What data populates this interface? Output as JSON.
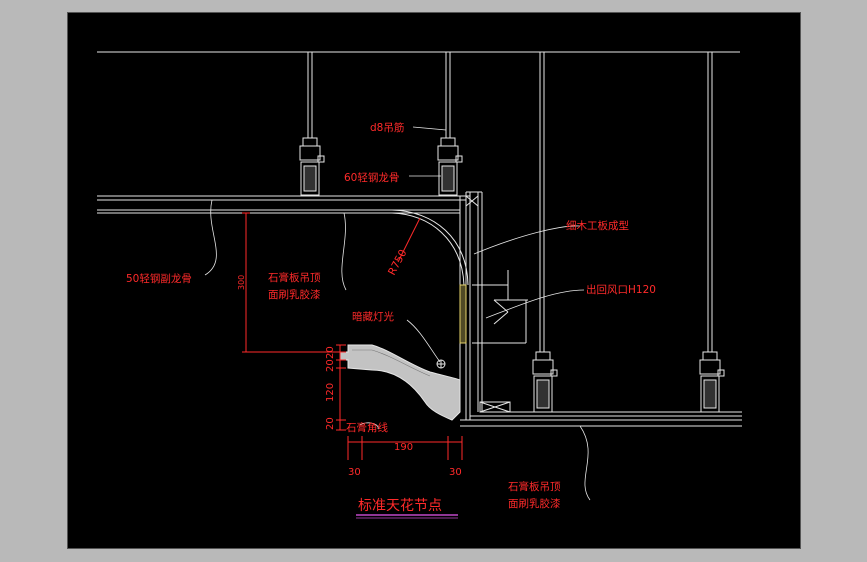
{
  "colors": {
    "background": "#b9b9b9",
    "canvas": "#000000",
    "annotation": "#ff2a2a",
    "line": "#e6e6e6",
    "fill": "#c8c8c8",
    "accent": "#e6d36a"
  },
  "drawing": {
    "title": "标准天花节点",
    "labels": {
      "rod": "d8吊筋",
      "main_keel": "60轻钢龙骨",
      "sub_keel": "50轻钢副龙骨",
      "gypsum_top_1": "石膏板吊顶",
      "gypsum_top_2": "面刷乳胶漆",
      "radius": "R750",
      "wood_shape": "细木工板成型",
      "air_outlet": "出回风口H120",
      "hidden_light": "暗藏灯光",
      "gypsum_molding": "石膏角线",
      "gypsum_bottom_1": "石膏板吊顶",
      "gypsum_bottom_2": "面刷乳胶漆"
    },
    "dimensions": {
      "height_300": "300",
      "dim_20_a": "20",
      "dim_20_b": "20",
      "dim_120": "120",
      "dim_20_c": "20",
      "dim_190": "190",
      "dim_30_left": "30",
      "dim_30_right": "30"
    }
  }
}
